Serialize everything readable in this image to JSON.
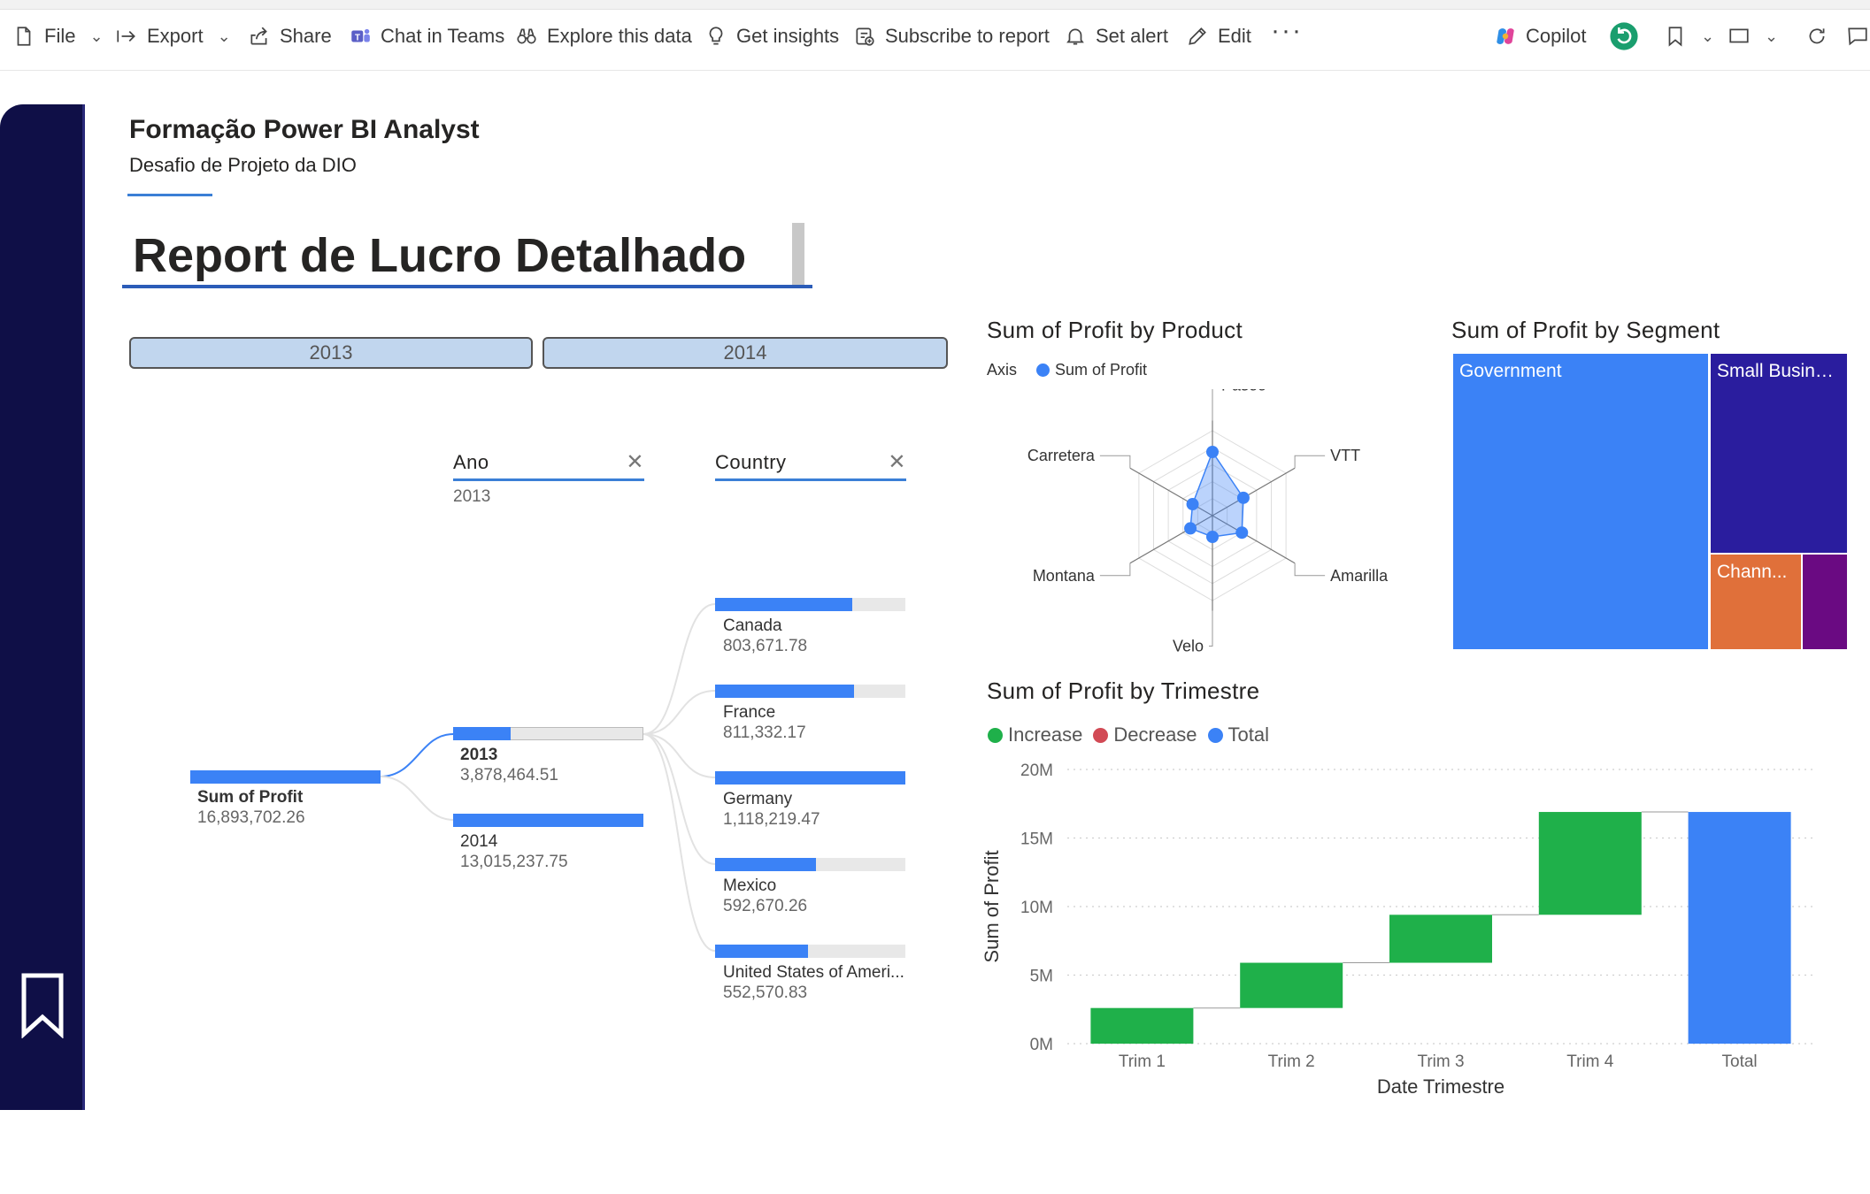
{
  "toolbar": {
    "file": "File",
    "export": "Export",
    "share": "Share",
    "chat_in_teams": "Chat in Teams",
    "explore": "Explore this data",
    "insights": "Get insights",
    "subscribe": "Subscribe to report",
    "alert": "Set alert",
    "edit": "Edit",
    "more": "···",
    "copilot": "Copilot"
  },
  "header": {
    "title": "Formação Power BI Analyst",
    "subtitle": "Desafio de Projeto da DIO",
    "report_title": "Report de Lucro Detalhado"
  },
  "year_buttons": [
    "2013",
    "2014"
  ],
  "slicers": {
    "ano": {
      "label": "Ano",
      "value": "2013"
    },
    "country": {
      "label": "Country",
      "value": ""
    }
  },
  "decomposition_tree": {
    "root": {
      "label": "Sum of Profit",
      "value": "16,893,702.26"
    },
    "years": [
      {
        "label": "2013",
        "value": "3,878,464.51",
        "share": 0.3
      },
      {
        "label": "2014",
        "value": "13,015,237.75",
        "share": 1.0
      }
    ],
    "countries": [
      {
        "label": "Canada",
        "value": "803,671.78",
        "share": 0.72
      },
      {
        "label": "France",
        "value": "811,332.17",
        "share": 0.73
      },
      {
        "label": "Germany",
        "value": "1,118,219.47",
        "share": 1.0
      },
      {
        "label": "Mexico",
        "value": "592,670.26",
        "share": 0.53
      },
      {
        "label": "United States of Ameri...",
        "value": "552,570.83",
        "share": 0.49
      }
    ]
  },
  "radar": {
    "title": "Sum of Profit by Product",
    "legend_axis": "Axis",
    "legend_series": "Sum of Profit",
    "color": "#3b82f6"
  },
  "treemap": {
    "title": "Sum of Profit by Segment",
    "cells": [
      {
        "label": "Government",
        "color": "#3b82f6"
      },
      {
        "label": "Small Busine...",
        "color": "#2a1d9e"
      },
      {
        "label": "Chann...",
        "color": "#e0703a"
      },
      {
        "label": "",
        "color": "#6a0a82"
      }
    ]
  },
  "waterfall": {
    "title": "Sum of Profit by Trimestre",
    "legend": [
      {
        "label": "Increase",
        "color": "#1fb04a"
      },
      {
        "label": "Decrease",
        "color": "#d24a55"
      },
      {
        "label": "Total",
        "color": "#3b82f6"
      }
    ],
    "xlabel": "Date Trimestre",
    "ylabel": "Sum of Profit"
  },
  "chart_data": [
    {
      "type": "radar",
      "title": "Sum of Profit by Product",
      "categories": [
        "Paseo",
        "VTT",
        "Amarilla",
        "Velo",
        "Montana",
        "Carretera"
      ],
      "series": [
        {
          "name": "Sum of Profit",
          "values": [
            0.75,
            0.42,
            0.4,
            0.25,
            0.3,
            0.27
          ]
        }
      ]
    },
    {
      "type": "treemap",
      "title": "Sum of Profit by Segment",
      "categories": [
        "Government",
        "Small Busine...",
        "Chann...",
        ""
      ],
      "values": [
        0.58,
        0.26,
        0.11,
        0.05
      ]
    },
    {
      "type": "bar",
      "subtype": "waterfall",
      "title": "Sum of Profit by Trimestre",
      "categories": [
        "Trim 1",
        "Trim 2",
        "Trim 3",
        "Trim 4",
        "Total"
      ],
      "start": [
        0,
        2.6,
        5.9,
        9.4,
        0
      ],
      "end": [
        2.6,
        5.9,
        9.4,
        16.9,
        16.9
      ],
      "kind": [
        "increase",
        "increase",
        "increase",
        "increase",
        "total"
      ],
      "xlabel": "Date Trimestre",
      "ylabel": "Sum of Profit",
      "yticks": [
        "0M",
        "5M",
        "10M",
        "15M",
        "20M"
      ],
      "ylim": [
        0,
        20
      ]
    }
  ]
}
